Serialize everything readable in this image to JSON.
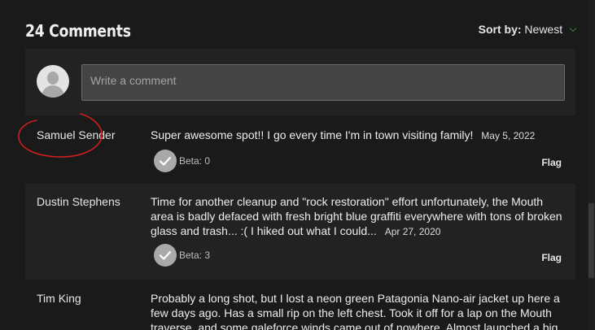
{
  "header": {
    "title": "24 Comments",
    "sort_label": "Sort by:",
    "sort_value": "Newest"
  },
  "composer": {
    "placeholder": "Write a comment"
  },
  "comments": [
    {
      "author": "Samuel Sender",
      "text": "Super awesome spot!! I go every time I'm in town visiting family!",
      "date": "May 5, 2022",
      "beta": "Beta: 0",
      "flag": "Flag",
      "author_circled": true
    },
    {
      "author": "Dustin Stephens",
      "text": "Time for another cleanup and \"rock restoration\" effort unfortunately, the Mouth area is badly defaced with fresh bright blue graffiti everywhere with tons of broken glass and trash... :( I hiked out what I could...",
      "date": "Apr 27, 2020",
      "beta": "Beta: 3",
      "flag": "Flag"
    },
    {
      "author": "Tim King",
      "text": "Probably a long shot, but I lost a neon green Patagonia Nano-air jacket up here a few days ago. Has a small rip on the left chest. Took it off for a lap on the Mouth traverse, and some galeforce winds came out of nowhere. Almost launched a big"
    }
  ],
  "colors": {
    "background": "#1a1a1a",
    "panel": "#222222",
    "annotation": "#cc1f1f"
  }
}
